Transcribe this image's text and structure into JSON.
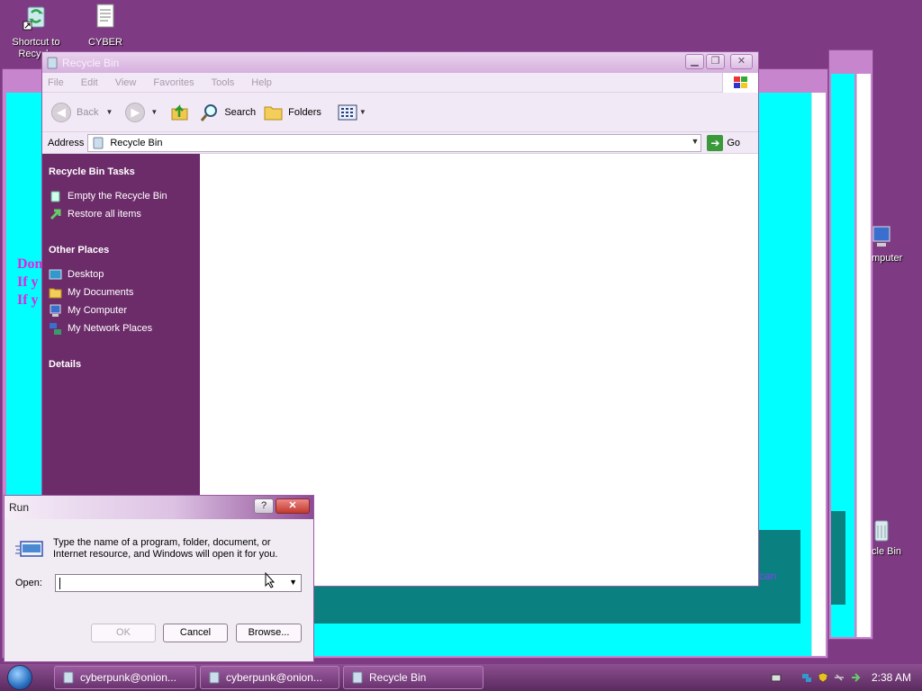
{
  "desktop": {
    "icons": [
      {
        "label_line1": "Shortcut to",
        "label_line2": "Recycle"
      },
      {
        "label_line1": "CYBER",
        "label_line2": ""
      }
    ],
    "right_icons": [
      {
        "label": "mputer"
      },
      {
        "label": "cle Bin"
      }
    ]
  },
  "background_window": {
    "lines": [
      "Don",
      "If y",
      "If y"
    ],
    "partial_text": "can"
  },
  "explorer": {
    "title": "Recycle Bin",
    "menu": [
      "File",
      "Edit",
      "View",
      "Favorites",
      "Tools",
      "Help"
    ],
    "toolbar": {
      "back": "Back",
      "search": "Search",
      "folders": "Folders"
    },
    "address": {
      "label": "Address",
      "value": "Recycle Bin",
      "go": "Go"
    },
    "tasks": {
      "section1_title": "Recycle Bin Tasks",
      "section1_items": [
        "Empty the Recycle Bin",
        "Restore all items"
      ],
      "section2_title": "Other Places",
      "section2_items": [
        "Desktop",
        "My Documents",
        "My Computer",
        "My Network Places"
      ],
      "section3_title": "Details"
    }
  },
  "run_dialog": {
    "title": "Run",
    "help": "?",
    "description_line1": "Type the name of a program, folder, document, or",
    "description_line2": "Internet resource, and Windows will open it for you.",
    "open_label": "Open:",
    "open_value": "",
    "ok": "OK",
    "cancel": "Cancel",
    "browse": "Browse..."
  },
  "taskbar": {
    "items": [
      "cyberpunk@onion...",
      "cyberpunk@onion...",
      "Recycle Bin"
    ],
    "clock": "2:38 AM"
  },
  "colors": {
    "desktop": "#7e3a82",
    "task_pane": "#6c2c69",
    "cyan": "#00ffff",
    "teal": "#0b8080"
  }
}
